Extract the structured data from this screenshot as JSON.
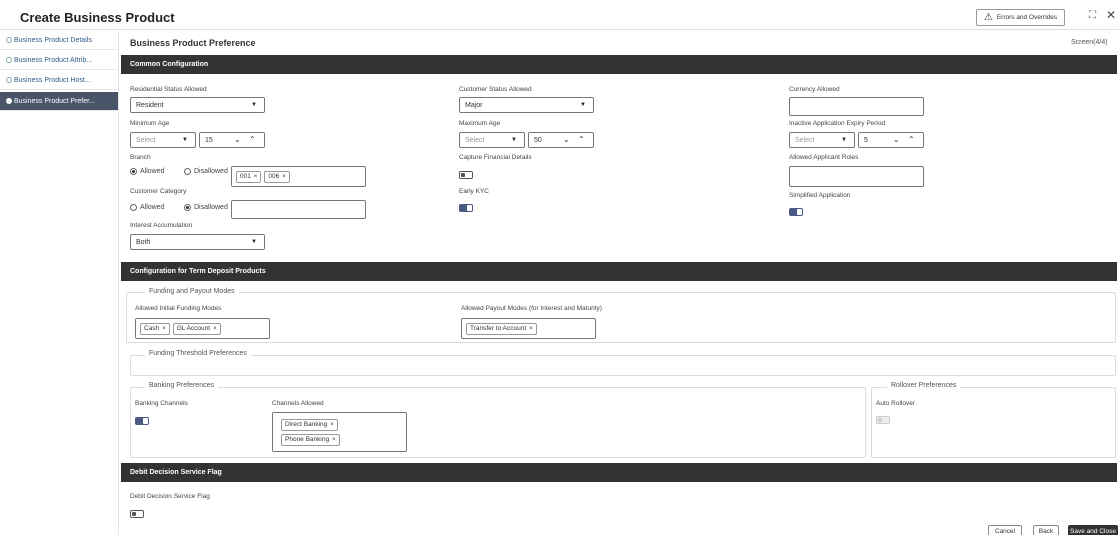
{
  "app": {
    "title": "Create Business Product",
    "errors_button": "Errors and Overrides",
    "screen": "Screen(4/4)"
  },
  "sidebar": {
    "items": [
      {
        "label": "Business Product Details"
      },
      {
        "label": "Business Product Attrib..."
      },
      {
        "label": "Business Product Host..."
      },
      {
        "label": "Business Product Prefer..."
      }
    ]
  },
  "main": {
    "title": "Business Product Preference"
  },
  "common": {
    "section_title": "Common Configuration",
    "residential_label": "Residential Status Allowed",
    "residential_value": "Resident",
    "customer_status_label": "Customer Status Allowed",
    "customer_status_value": "Major",
    "currency_label": "Currency Allowed",
    "currency_value": "",
    "min_age_label": "Minimum Age",
    "min_age_select": "Select",
    "min_age_value": "15",
    "max_age_label": "Maximum Age",
    "max_age_select": "Select",
    "max_age_value": "50",
    "inactive_label": "Inactive Application Expiry Period",
    "inactive_select": "Select",
    "inactive_value": "5",
    "branch_label": "Branch",
    "branch_allowed": "Allowed",
    "branch_disallowed": "Disallowed",
    "branch_chips": [
      "001",
      "006"
    ],
    "capture_fin_label": "Capture Financial Details",
    "applicant_roles_label": "Allowed Applicant Roles",
    "customer_category_label": "Customer Category",
    "cat_allowed": "Allowed",
    "cat_disallowed": "Disallowed",
    "early_kyc_label": "Early KYC",
    "simplified_label": "Simplified Application",
    "interest_label": "Interest Accumulation",
    "interest_value": "Both"
  },
  "term_deposit": {
    "section_title": "Configuration for Term Deposit Products",
    "funding_legend": "Funding and Payout Modes",
    "initial_funding_label": "Allowed Initial Funding Modes",
    "initial_funding_chips": [
      "Cash",
      "GL Account"
    ],
    "payout_label": "Allowed Payout Modes (for Interest and Maturity)",
    "payout_chips": [
      "Transfer to Account"
    ],
    "threshold_legend": "Funding Threshold Preferences",
    "banking_legend": "Banking Preferences",
    "banking_channels_label": "Banking Channels",
    "channels_allowed_label": "Channels Allowed",
    "channels_chips": [
      "Direct Banking",
      "Phone Banking"
    ],
    "rollover_legend": "Rollover Preferences",
    "auto_rollover_label": "Auto Rollover"
  },
  "debit": {
    "section_title": "Debit Decision Service Flag",
    "flag_label": "Debit Decision Service Flag"
  },
  "footer": {
    "cancel": "Cancel",
    "back": "Back",
    "save_close": "Save and Close"
  }
}
